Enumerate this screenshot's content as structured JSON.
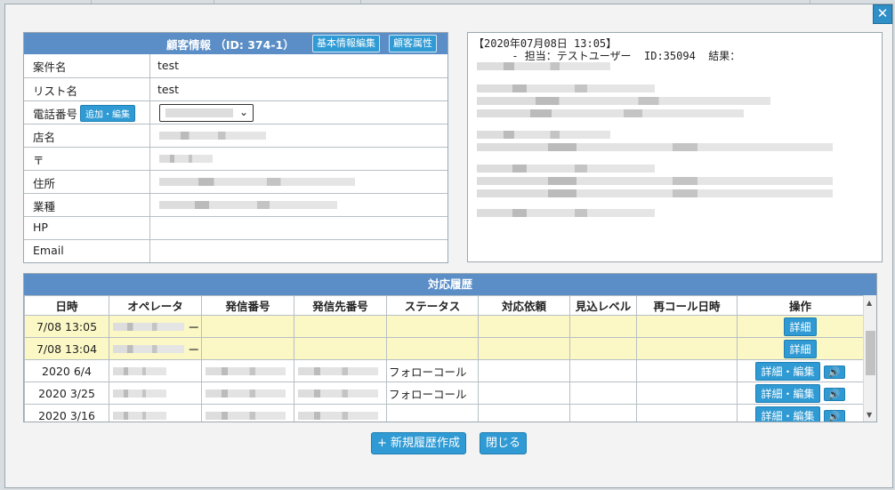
{
  "customer": {
    "title": "顧客情報 （ID: 374-1）",
    "edit_basic_label": "基本情報編集",
    "attributes_label": "顧客属性",
    "fields": [
      {
        "label": "案件名",
        "value": "test"
      },
      {
        "label": "リスト名",
        "value": "test"
      },
      {
        "label": "電話番号",
        "value": ""
      },
      {
        "label": "店名",
        "value": ""
      },
      {
        "label": "〒",
        "value": ""
      },
      {
        "label": "住所",
        "value": ""
      },
      {
        "label": "業種",
        "value": ""
      },
      {
        "label": "HP",
        "value": ""
      },
      {
        "label": "Email",
        "value": ""
      }
    ],
    "phone_edit_label": "追加・編集"
  },
  "note": {
    "line1": "【2020年07月08日 13:05】",
    "line2": "      - 担当：テストユーザー  ID:35094  結果："
  },
  "history": {
    "title": "対応履歴",
    "columns": [
      "日時",
      "オペレータ",
      "発信番号",
      "発信先番号",
      "ステータス",
      "対応依頼",
      "見込レベル",
      "再コール日時",
      "操作"
    ],
    "rows": [
      {
        "datetime": "7/08 13:05",
        "operator_suffix": "ー",
        "status": "",
        "action": "詳細",
        "highlight": true
      },
      {
        "datetime": "7/08 13:04",
        "operator_suffix": "ー",
        "status": "",
        "action": "詳細",
        "highlight": true
      },
      {
        "datetime": "2020 6/4",
        "operator_suffix": "",
        "status": "フォローコール",
        "action": "詳細・編集",
        "highlight": false
      },
      {
        "datetime": "2020 3/25",
        "operator_suffix": "",
        "status": "フォローコール",
        "action": "詳細・編集",
        "highlight": false
      },
      {
        "datetime": "2020 3/16",
        "operator_suffix": "",
        "status": "",
        "action": "詳細・編集",
        "highlight": false
      }
    ]
  },
  "footer": {
    "new_label": "+ 新規履歴作成",
    "close_label": "閉じる"
  },
  "close_symbol": "✕",
  "speaker_symbol": "🔊",
  "colors": {
    "header": "#5b8ec6",
    "button": "#2f9ad3",
    "highlight": "#fbf8c6"
  }
}
